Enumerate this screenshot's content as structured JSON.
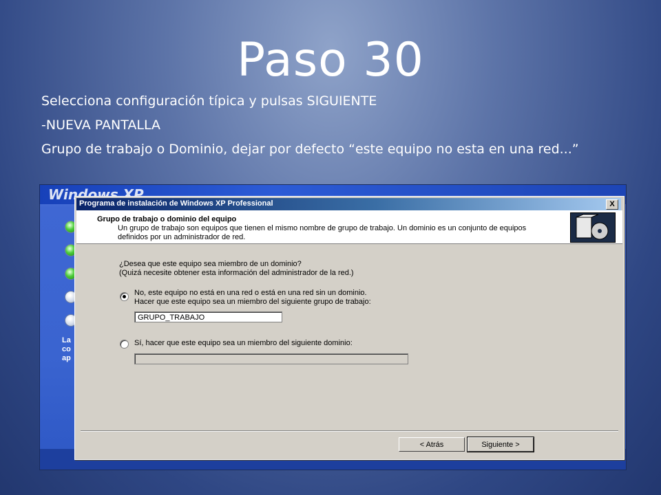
{
  "slide": {
    "title": "Paso 30",
    "lines": [
      "Selecciona configuración típica y pulsas SIGUIENTE",
      "-NUEVA PANTALLA",
      "Grupo de trabajo o Dominio, dejar por defecto “este equipo no esta en una red...”"
    ]
  },
  "xp": {
    "logo": "Windows XP",
    "side_text": [
      "La",
      "co",
      "ap"
    ]
  },
  "dialog": {
    "title": "Programa de instalación de Windows XP Professional",
    "close": "X",
    "header_title": "Grupo de trabajo o dominio del equipo",
    "header_desc": "Un grupo de trabajo son equipos que tienen el mismo nombre de grupo de trabajo. Un dominio es un conjunto de equipos definidos por un administrador de red.",
    "question_1": "¿Desea que este equipo sea miembro de un dominio?",
    "question_2": "(Quizá necesite obtener esta información del administrador de la red.)",
    "option_no_1": "No, este equipo no está en una red o está en una red sin un dominio.",
    "option_no_2": "Hacer que este equipo sea un miembro del siguiente grupo de trabajo:",
    "workgroup_value": "GRUPO_TRABAJO",
    "option_yes": "Sí, hacer que este equipo sea un miembro del siguiente dominio:",
    "domain_value": "",
    "back_label": "< Atrás",
    "next_label": "Siguiente >"
  },
  "colors": {
    "titlebar": "#0a246a",
    "dialog_face": "#d4d0c8",
    "xp_blue": "#3a64d0"
  }
}
